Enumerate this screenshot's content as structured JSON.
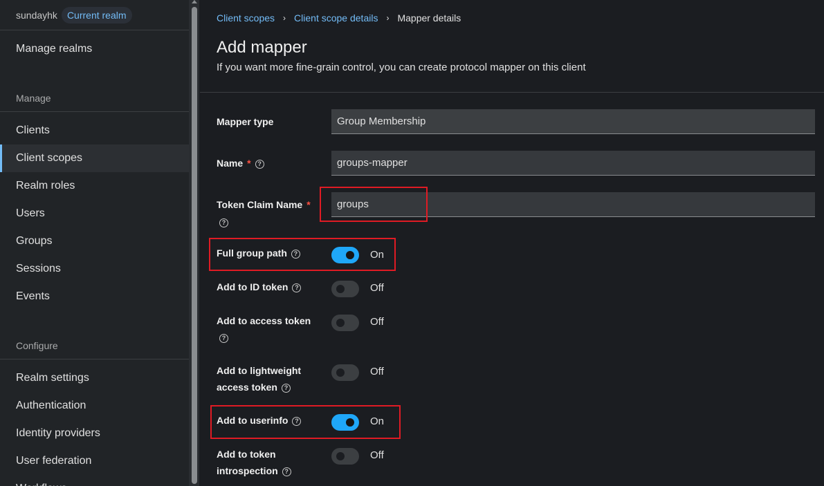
{
  "realm": {
    "name": "sundayhk",
    "badge": "Current realm"
  },
  "sidebar": {
    "manage_realms": "Manage realms",
    "section_manage": "Manage",
    "section_configure": "Configure",
    "items": [
      {
        "label": "Clients"
      },
      {
        "label": "Client scopes",
        "active": true
      },
      {
        "label": "Realm roles"
      },
      {
        "label": "Users"
      },
      {
        "label": "Groups"
      },
      {
        "label": "Sessions"
      },
      {
        "label": "Events"
      }
    ],
    "configure_items": [
      {
        "label": "Realm settings"
      },
      {
        "label": "Authentication"
      },
      {
        "label": "Identity providers"
      },
      {
        "label": "User federation"
      },
      {
        "label": "Workflows"
      }
    ]
  },
  "breadcrumb": {
    "items": [
      "Client scopes",
      "Client scope details"
    ],
    "current": "Mapper details",
    "separator": "›"
  },
  "page": {
    "title": "Add mapper",
    "description": "If you want more fine-grain control, you can create protocol mapper on this client"
  },
  "form": {
    "mapper_type": {
      "label": "Mapper type",
      "value": "Group Membership"
    },
    "name": {
      "label": "Name",
      "value": "groups-mapper"
    },
    "token_claim_name": {
      "label": "Token Claim Name",
      "value": "groups"
    },
    "full_group_path": {
      "label": "Full group path",
      "state": "On"
    },
    "add_to_id_token": {
      "label": "Add to ID token",
      "state": "Off"
    },
    "add_to_access_token": {
      "label": "Add to access token",
      "state": "Off"
    },
    "add_to_lightweight": {
      "label_line1": "Add to lightweight",
      "label_line2": "access token",
      "state": "Off"
    },
    "add_to_userinfo": {
      "label": "Add to userinfo",
      "state": "On"
    },
    "add_to_introspection": {
      "label_line1": "Add to token",
      "label_line2": "introspection",
      "state": "Off"
    },
    "required_mark": "*",
    "help_glyph": "?"
  },
  "colors": {
    "accent": "#73bcf7",
    "switch_on": "#1fa7f8",
    "highlight": "#e01b24",
    "required": "#fe5142"
  }
}
